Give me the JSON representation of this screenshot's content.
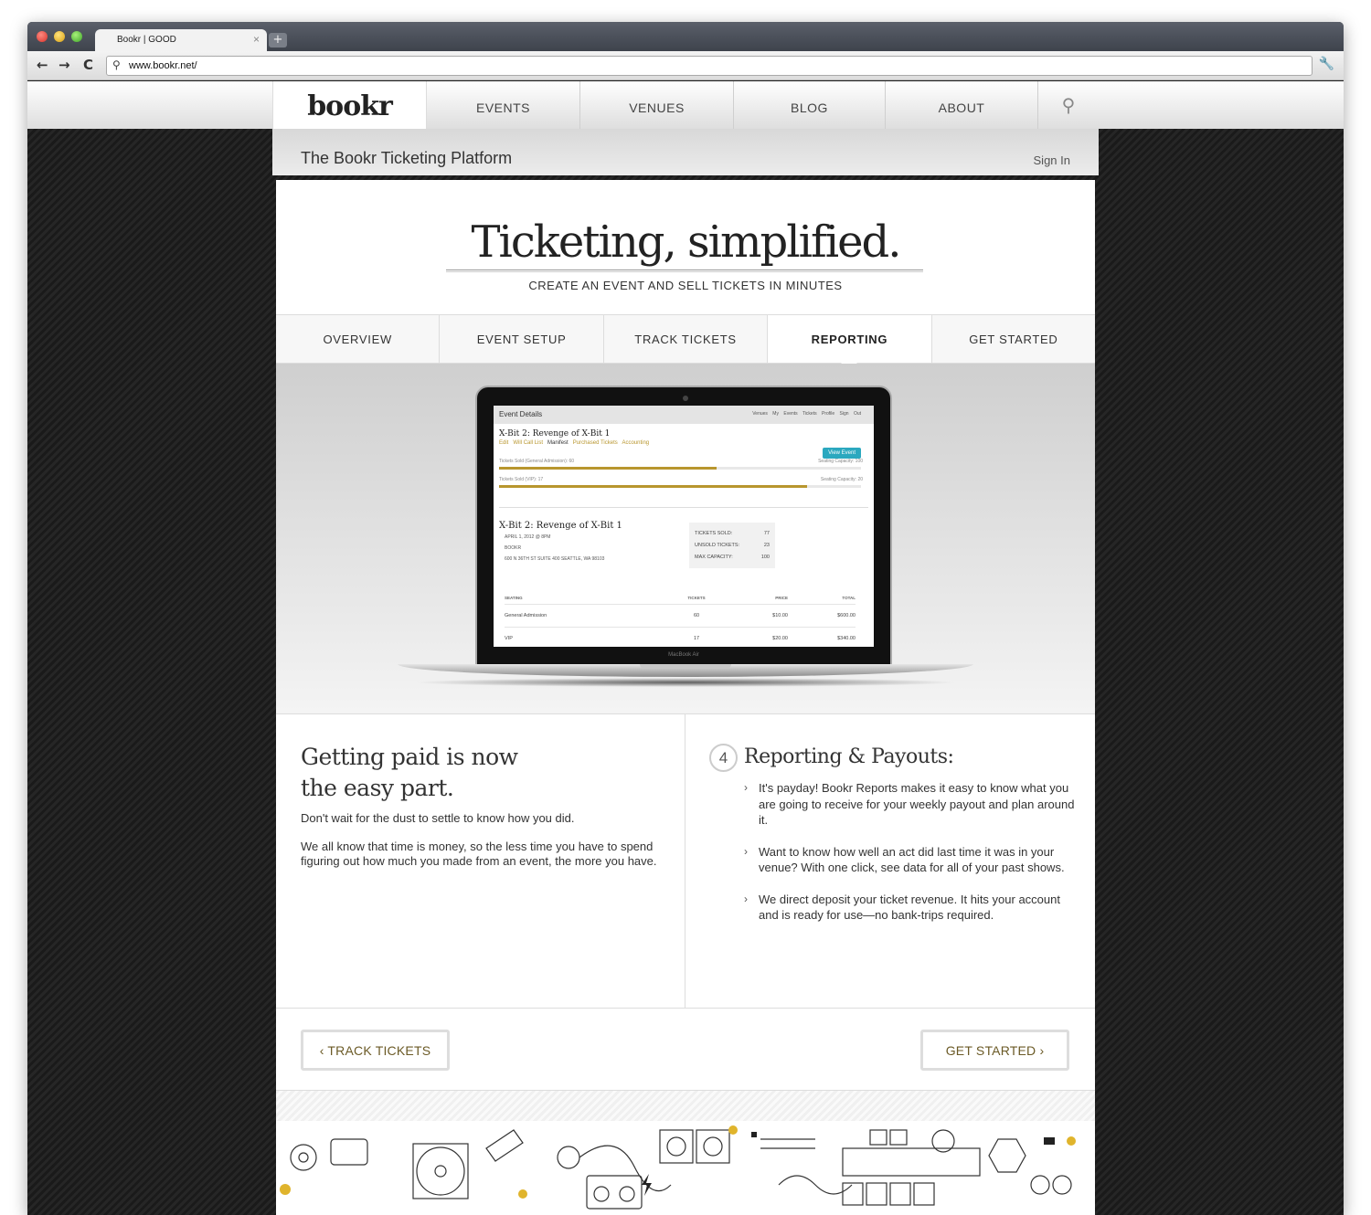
{
  "browser": {
    "tab_title": "Bookr | GOOD",
    "tab_close": "×",
    "new_tab": "+",
    "back": "←",
    "forward": "→",
    "reload": "C",
    "url": "www.bookr.net/",
    "search_glyph": "⚲",
    "wrench_glyph": "🔧"
  },
  "nav": {
    "logo": "bookr",
    "items": [
      "EVENTS",
      "VENUES",
      "BLOG",
      "ABOUT"
    ],
    "search_glyph": "⚲"
  },
  "subheader": {
    "title": "The Bookr Ticketing Platform",
    "signin": "Sign In"
  },
  "hero": {
    "title": "Ticketing, simplified.",
    "subtitle": "CREATE AN EVENT AND SELL TICKETS IN MINUTES"
  },
  "tabs": [
    "OVERVIEW",
    "EVENT SETUP",
    "TRACK TICKETS",
    "REPORTING",
    "GET STARTED"
  ],
  "active_tab": "REPORTING",
  "screen": {
    "top_title": "Event Details",
    "top_nav": "Venues My Events Tickets Profile Sign Out",
    "event_name": "X-Bit 2: Revenge of X-Bit 1",
    "links": [
      "Edit",
      "Will Call List",
      "Manifest",
      "Purchased Tickets",
      "Accounting"
    ],
    "view_button": "View Event",
    "bars": [
      {
        "label": "Tickets Sold (General Admission): 60",
        "capacity": "Seating Capacity: 100",
        "fraction": 0.6
      },
      {
        "label": "Tickets Sold (VIP): 17",
        "capacity": "Seating Capacity: 20",
        "fraction": 0.85
      }
    ],
    "event_title2": "X-Bit 2: Revenge of X-Bit 1",
    "event_date": "APRIL 1, 2012 @ 8PM",
    "venue": "BOOKR",
    "address": "600 N 36TH ST SUITE 400 SEATTLE, WA 98103",
    "stats": [
      {
        "label": "TICKETS SOLD:",
        "value": "77"
      },
      {
        "label": "UNSOLD TICKETS:",
        "value": "23"
      },
      {
        "label": "MAX CAPACITY:",
        "value": "100"
      }
    ],
    "table_head": [
      "SEATING",
      "TICKETS",
      "PRICE",
      "TOTAL"
    ],
    "table_rows": [
      [
        "General Admission",
        "60",
        "$10.00",
        "$600.00"
      ],
      [
        "VIP",
        "17",
        "$20.00",
        "$340.00"
      ]
    ],
    "laptop_label": "MacBook Air"
  },
  "left_col": {
    "heading_line1": "Getting paid is now",
    "heading_line2": "the easy part.",
    "para1": "Don't wait for the dust to settle to know how you did.",
    "para2": "We all know that time is money, so the less time you have to spend figuring out how much you made from an event, the more you have."
  },
  "right_col": {
    "number": "4",
    "heading": "Reporting & Payouts:",
    "chevron": "›",
    "bullets": [
      "It's payday! Bookr Reports makes it easy to know what you are going to receive for your weekly payout and plan around it.",
      "Want to know how well an act did last time it was in your venue? With one click, see data for all of your past shows.",
      "We direct deposit your ticket revenue. It hits your account and is ready for use—no bank-trips required."
    ]
  },
  "buttons": {
    "prev": "‹  TRACK TICKETS",
    "next": "GET STARTED ›"
  },
  "colors": {
    "accent_gold": "#b8962e",
    "view_button": "#2ba8bf",
    "button_text": "#6b5a26"
  }
}
